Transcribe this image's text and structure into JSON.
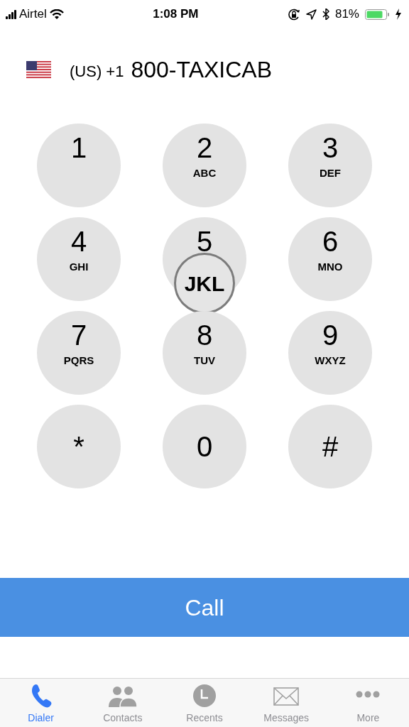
{
  "status_bar": {
    "carrier": "Airtel",
    "time": "1:08 PM",
    "battery": "81%"
  },
  "header": {
    "country": "(US) +1",
    "number": "800-TAXICAB"
  },
  "keys": [
    {
      "digit": "1"
    },
    {
      "digit": "2",
      "letters": "ABC"
    },
    {
      "digit": "3",
      "letters": "DEF"
    },
    {
      "digit": "4",
      "letters": "GHI"
    },
    {
      "digit": "5",
      "preview": "JKL"
    },
    {
      "digit": "6",
      "letters": "MNO"
    },
    {
      "digit": "7",
      "letters": "PQRS"
    },
    {
      "digit": "8",
      "letters": "TUV"
    },
    {
      "digit": "9",
      "letters": "WXYZ"
    },
    {
      "digit": "*"
    },
    {
      "digit": "0"
    },
    {
      "digit": "#"
    }
  ],
  "call_button": "Call",
  "tabs": [
    {
      "label": "Dialer",
      "selected": true
    },
    {
      "label": "Contacts",
      "selected": false
    },
    {
      "label": "Recents",
      "selected": false
    },
    {
      "label": "Messages",
      "selected": false
    },
    {
      "label": "More",
      "selected": false
    }
  ]
}
